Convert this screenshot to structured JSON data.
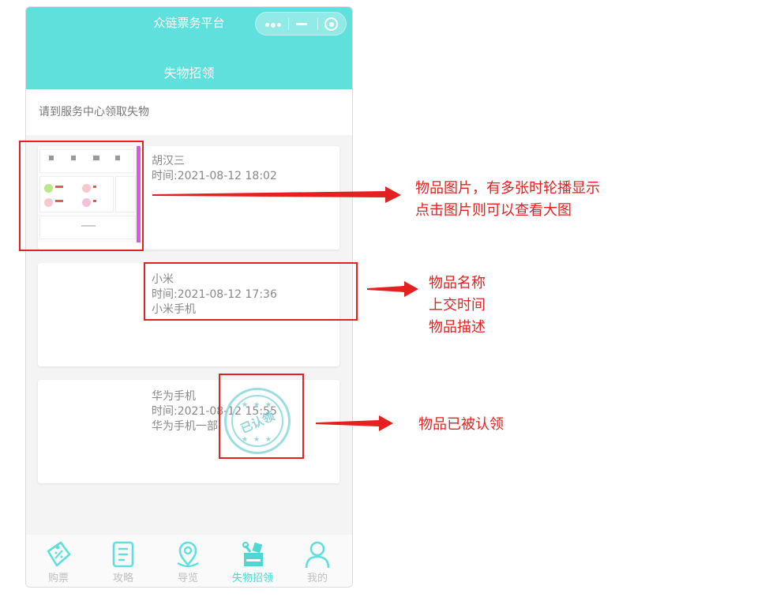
{
  "app": {
    "title": "众链票务平台"
  },
  "page": {
    "title": "失物招领"
  },
  "notice": "请到服务中心领取失物",
  "items": [
    {
      "name": "胡汉三",
      "time": "时间:2021-08-12 18:02",
      "desc": ""
    },
    {
      "name": "小米",
      "time": "时间:2021-08-12 17:36",
      "desc": "小米手机"
    },
    {
      "name": "华为手机",
      "time": "时间:2021-08-12 15:55",
      "desc": "华为手机一部"
    }
  ],
  "stamp": {
    "text": "已认领",
    "color": "#8ad8dc"
  },
  "tabs": [
    {
      "label": "购票",
      "icon": "ticket-icon",
      "active": false
    },
    {
      "label": "攻略",
      "icon": "document-icon",
      "active": false
    },
    {
      "label": "导览",
      "icon": "map-pin-icon",
      "active": false
    },
    {
      "label": "失物招领",
      "icon": "lost-found-box-icon",
      "active": true
    },
    {
      "label": "我的",
      "icon": "user-icon",
      "active": false
    }
  ],
  "annotations": {
    "image_line1": "物品图片，有多张时轮播显示",
    "image_line2": "点击图片则可以查看大图",
    "info_line1": "物品名称",
    "info_line2": "上交时间",
    "info_line3": "物品描述",
    "claimed": "物品已被认领"
  },
  "colors": {
    "header": "#5fe0dc",
    "tab_active": "#4fd7d2",
    "tab_inactive": "#bfbfbf",
    "annotation_red": "#e42020"
  }
}
